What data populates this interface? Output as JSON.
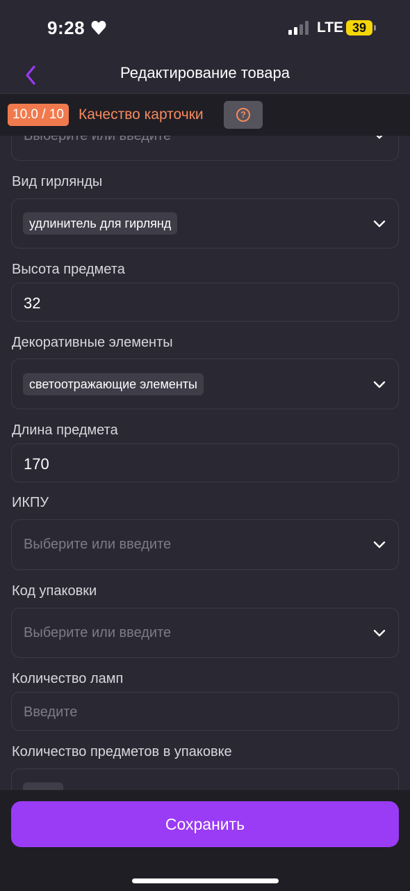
{
  "status_bar": {
    "time": "9:28",
    "network": "LTE",
    "battery": "39"
  },
  "nav": {
    "title": "Редактирование товара"
  },
  "quality": {
    "score": "10.0 / 10",
    "label": "Качество карточки",
    "accent_color": "#f07a4e"
  },
  "form": {
    "top_partial_placeholder": "Выберите или введите",
    "fields": [
      {
        "label": "Вид гирлянды",
        "chip": "удлинитель для гирлянд"
      },
      {
        "label": "Высота предмета",
        "value": "32"
      },
      {
        "label": "Декоративные элементы",
        "chip": "светоотражающие элементы"
      },
      {
        "label": "Длина предмета",
        "value": "170"
      },
      {
        "label": "ИКПУ",
        "placeholder": "Выберите или введите"
      },
      {
        "label": "Код упаковки",
        "placeholder": "Выберите или введите"
      },
      {
        "label": "Количество ламп",
        "placeholder": "Введите"
      },
      {
        "label": "Количество предметов в упаковке"
      }
    ]
  },
  "actions": {
    "save_label": "Сохранить",
    "save_color": "#9a3bf5"
  },
  "icons": {
    "back": "chevron-left-icon",
    "help": "question-circle-icon",
    "dropdown": "chevron-down-icon"
  }
}
